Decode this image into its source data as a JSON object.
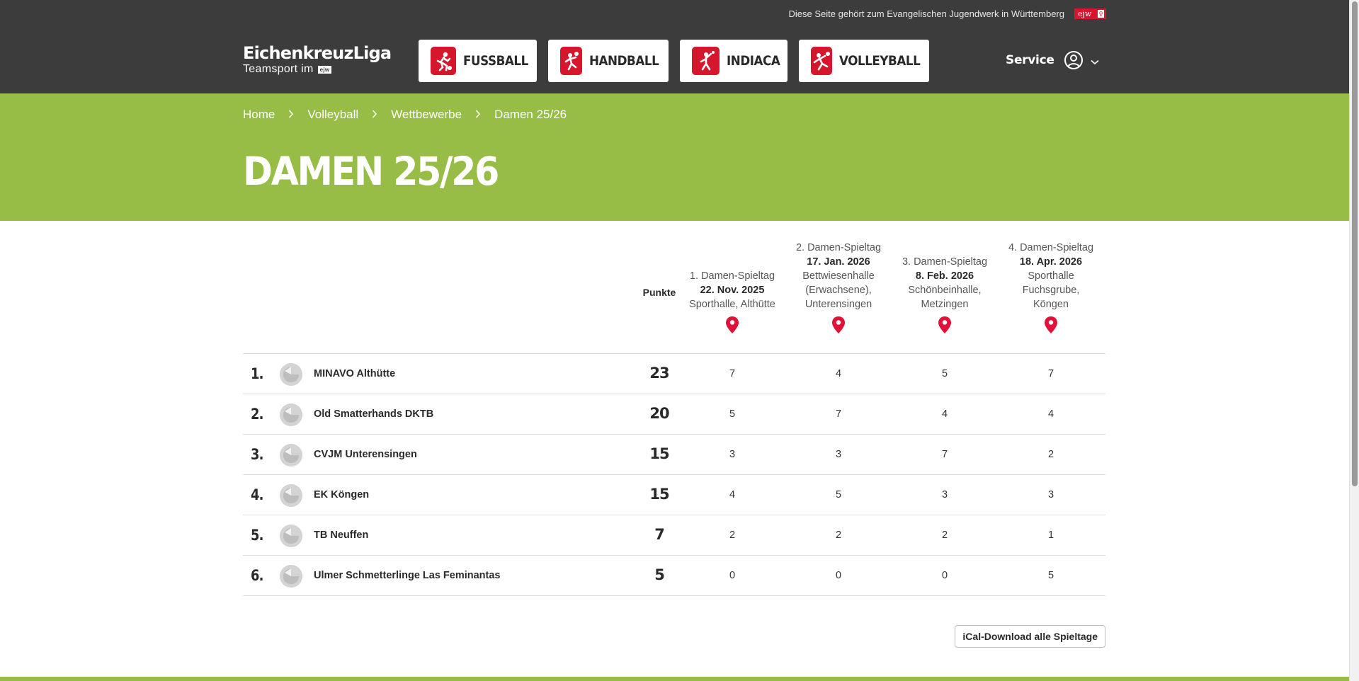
{
  "topbar": {
    "text": "Diese Seite gehört zum Evangelischen Jugendwerk in Württemberg",
    "badge": "ejw"
  },
  "logo": {
    "title": "EichenkreuzLiga",
    "subtitle": "Teamsport im",
    "subtitle_badge": "ejw"
  },
  "sports": [
    {
      "label": "FUSSBALL",
      "icon": "soccer-player-icon"
    },
    {
      "label": "HANDBALL",
      "icon": "handball-player-icon"
    },
    {
      "label": "INDIACA",
      "icon": "indiaca-player-icon"
    },
    {
      "label": "VOLLEYBALL",
      "icon": "volleyball-player-icon"
    }
  ],
  "service_label": "Service",
  "breadcrumb": [
    "Home",
    "Volleyball",
    "Wettbewerbe",
    "Damen 25/26"
  ],
  "page_title": "DAMEN 25/26",
  "table": {
    "points_header": "Punkte",
    "days": [
      {
        "name": "1. Damen-Spieltag",
        "date": "22. Nov. 2025",
        "venue": "Sporthalle, Althütte"
      },
      {
        "name": "2. Damen-Spieltag",
        "date": "17. Jan. 2026",
        "venue": "Bettwiesenhalle (Erwachsene), Unterensingen"
      },
      {
        "name": "3. Damen-Spieltag",
        "date": "8. Feb. 2026",
        "venue": "Schönbeinhalle, Metzingen"
      },
      {
        "name": "4. Damen-Spieltag",
        "date": "18. Apr. 2026",
        "venue": "Sporthalle Fuchsgrube, Köngen"
      }
    ],
    "rows": [
      {
        "rank": "1.",
        "team": "MINAVO Althütte",
        "points": "23",
        "scores": [
          "7",
          "4",
          "5",
          "7"
        ]
      },
      {
        "rank": "2.",
        "team": "Old Smatterhands DKTB",
        "points": "20",
        "scores": [
          "5",
          "7",
          "4",
          "4"
        ]
      },
      {
        "rank": "3.",
        "team": "CVJM Unterensingen",
        "points": "15",
        "scores": [
          "3",
          "3",
          "7",
          "2"
        ]
      },
      {
        "rank": "4.",
        "team": "EK Köngen",
        "points": "15",
        "scores": [
          "4",
          "5",
          "3",
          "3"
        ]
      },
      {
        "rank": "5.",
        "team": "TB Neuffen",
        "points": "7",
        "scores": [
          "2",
          "2",
          "2",
          "1"
        ]
      },
      {
        "rank": "6.",
        "team": "Ulmer Schmetterlinge Las Feminantas",
        "points": "5",
        "scores": [
          "0",
          "0",
          "0",
          "5"
        ]
      }
    ]
  },
  "ical_button": "iCal-Download alle Spieltage",
  "colors": {
    "header": "#3c3c3c",
    "accent_green": "#97bd46",
    "accent_red": "#d6162c"
  }
}
